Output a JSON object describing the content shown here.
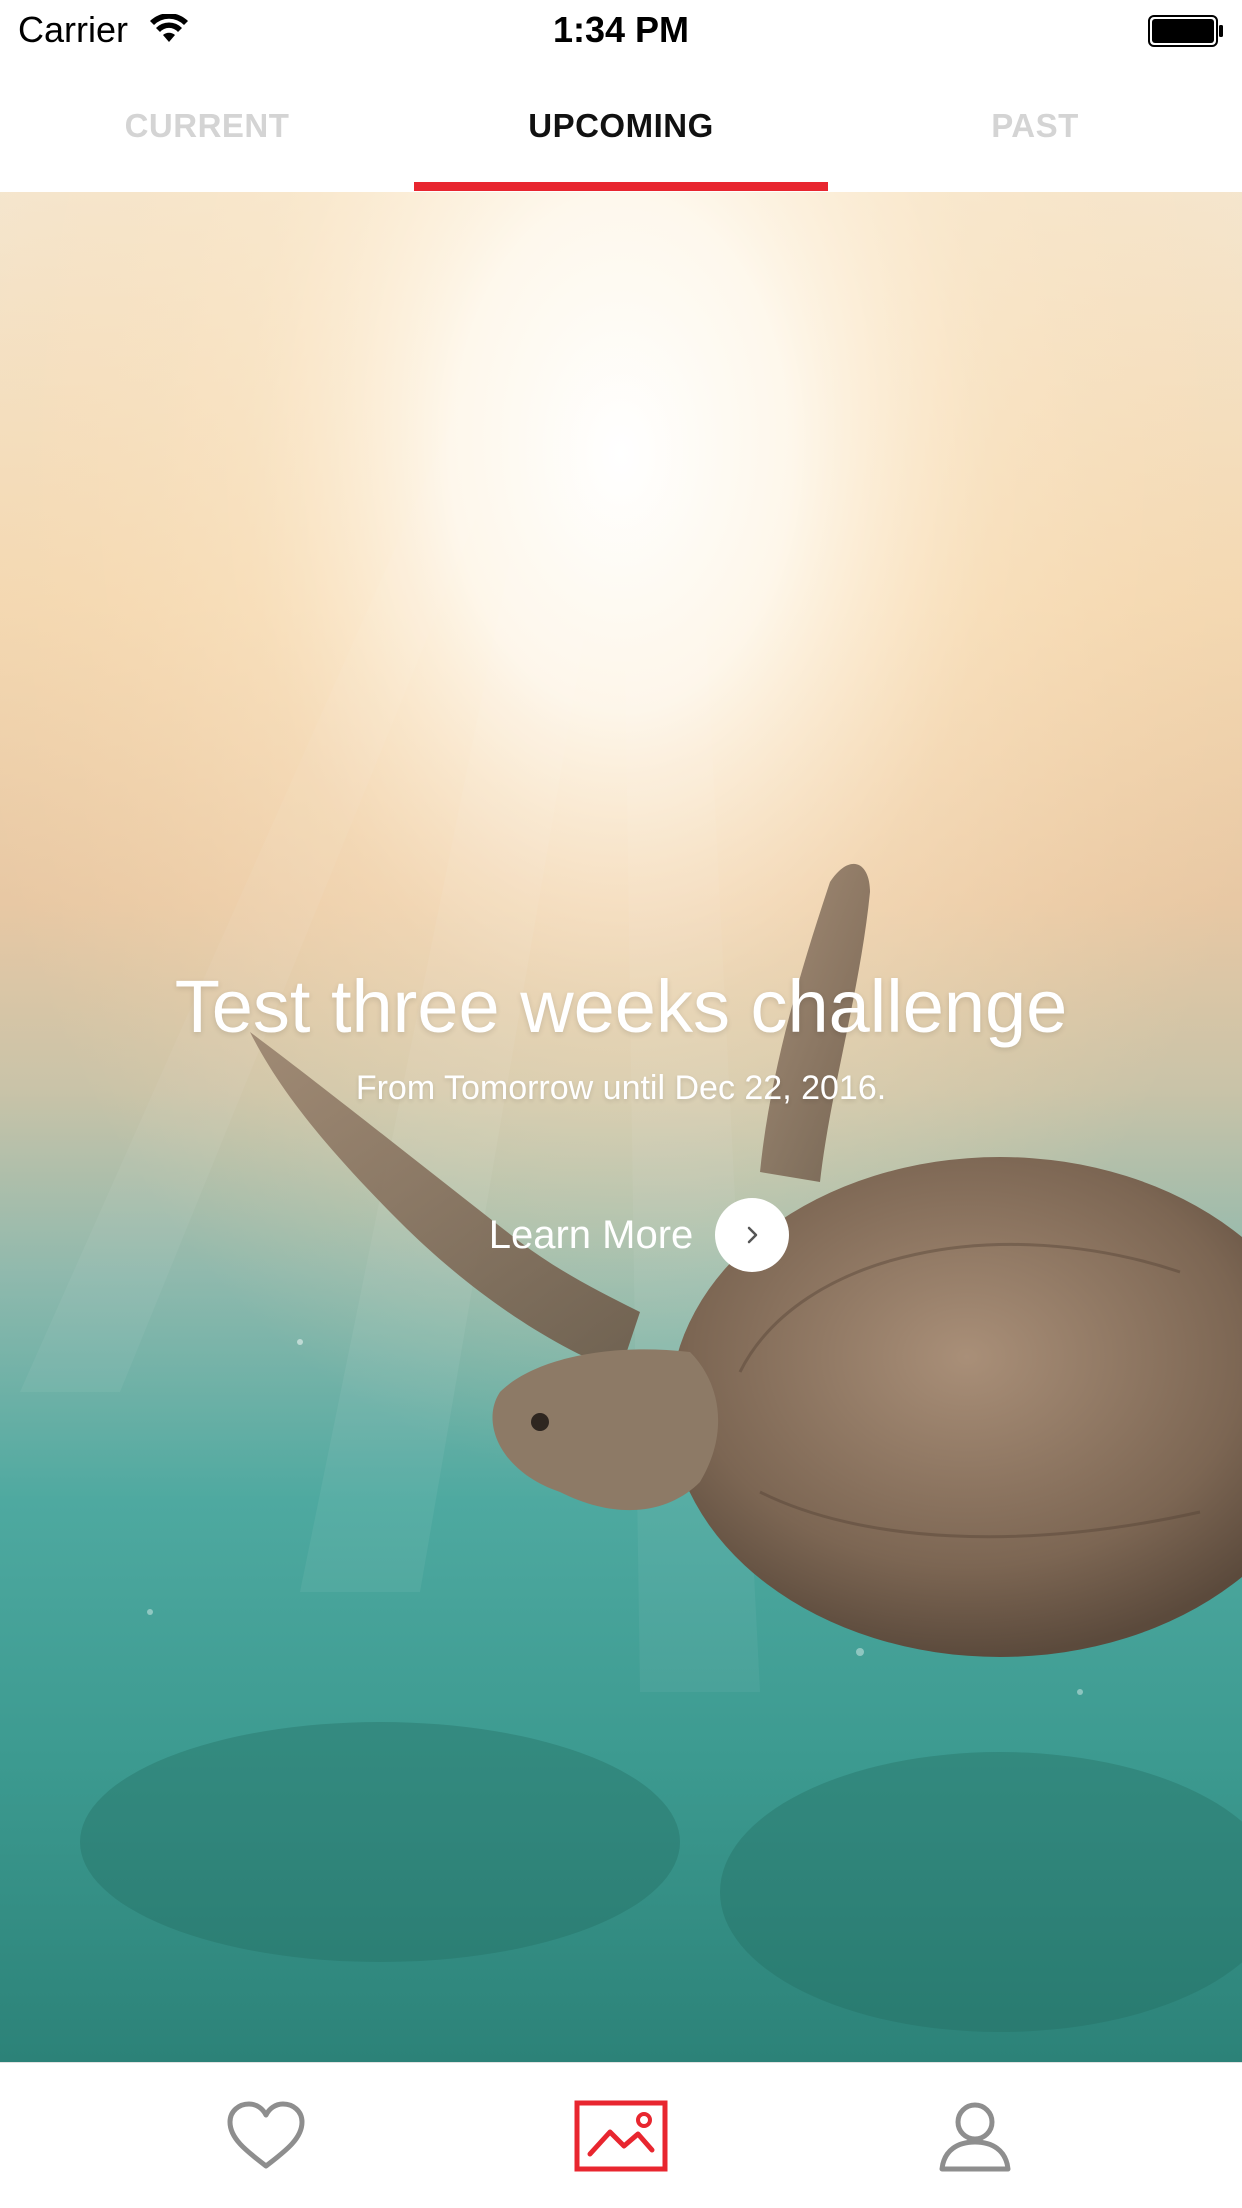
{
  "status_bar": {
    "carrier": "Carrier",
    "time": "1:34 PM",
    "wifi_icon": "wifi-icon",
    "battery_icon": "battery-icon"
  },
  "tabs": [
    {
      "label": "CURRENT",
      "active": false
    },
    {
      "label": "UPCOMING",
      "active": true
    },
    {
      "label": "PAST",
      "active": false
    }
  ],
  "hero": {
    "title": "Test three weeks challenge",
    "subtitle": "From Tomorrow until Dec 22, 2016.",
    "cta_label": "Learn More",
    "cta_icon": "chevron-right-icon"
  },
  "tab_bar": {
    "items": [
      {
        "icon": "heart-icon",
        "active": false
      },
      {
        "icon": "picture-icon",
        "active": true
      },
      {
        "icon": "person-icon",
        "active": false
      }
    ]
  },
  "colors": {
    "accent": "#e8262f",
    "tab_inactive": "#d4d4d4",
    "tab_active": "#111111",
    "tab_bar_icon": "#8e8e8e"
  }
}
